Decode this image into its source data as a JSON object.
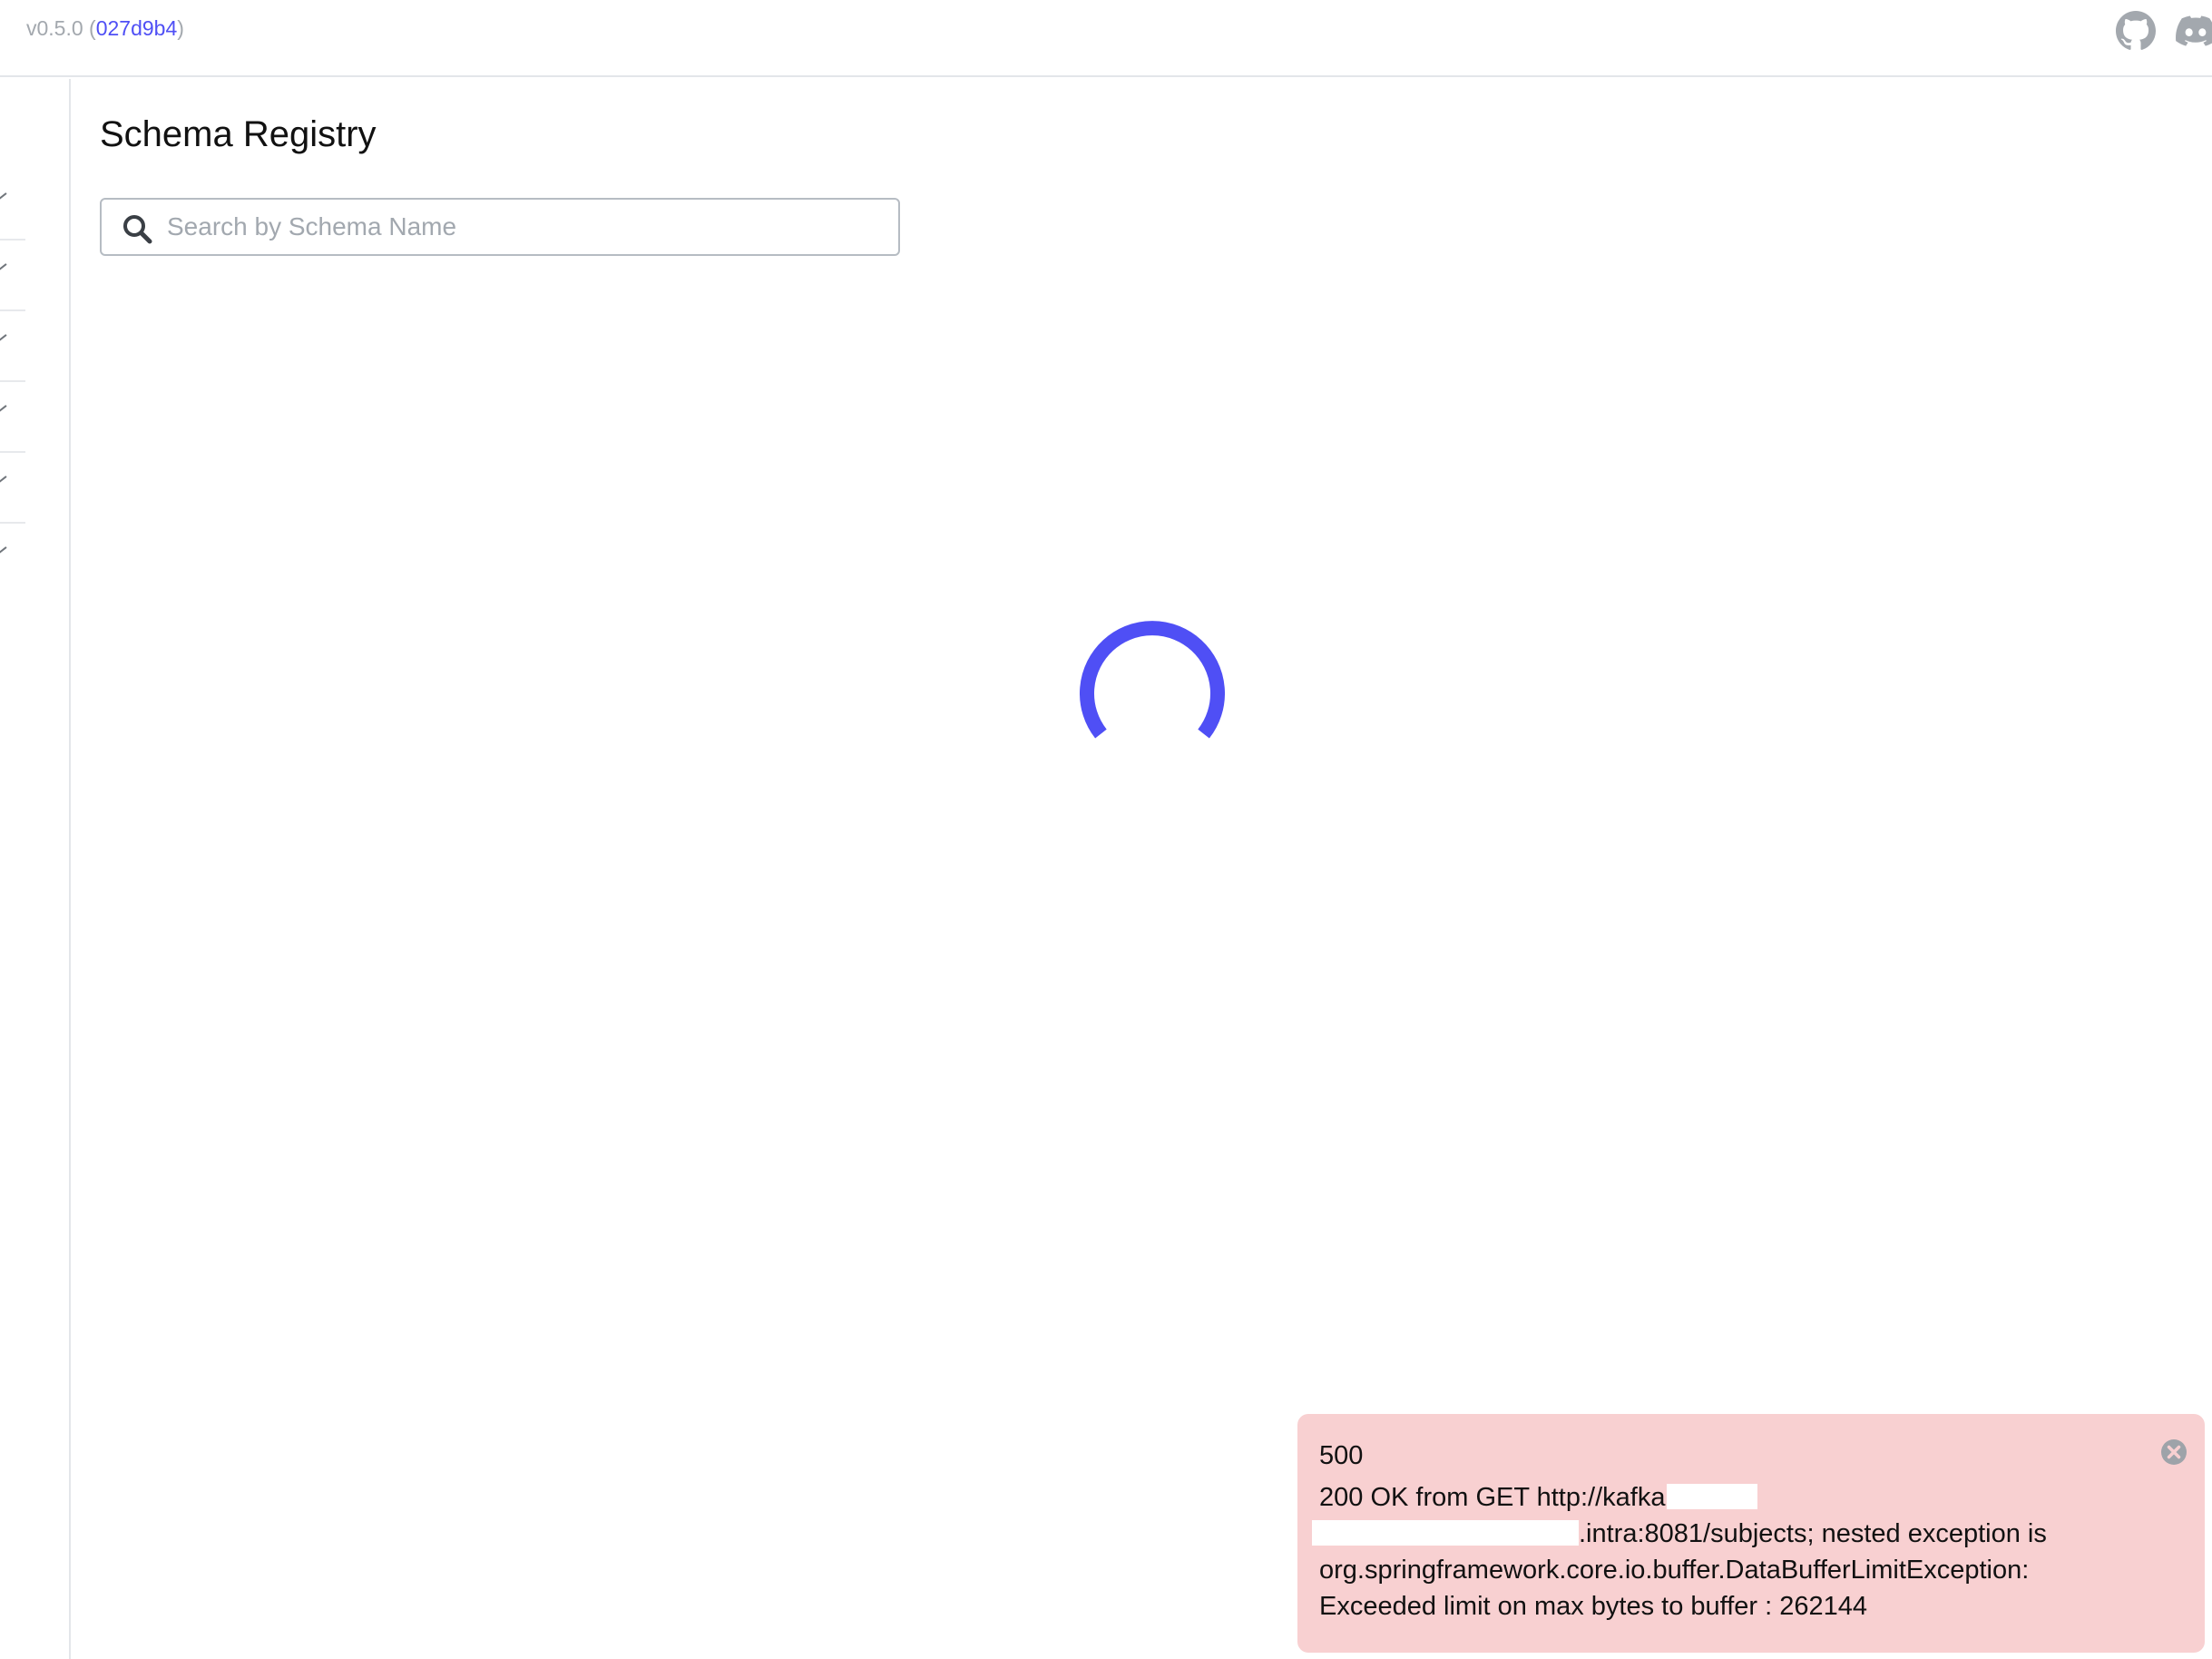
{
  "header": {
    "version": "v0.5.0",
    "commit_open": " (",
    "commit": "027d9b4",
    "commit_close": ")",
    "icons": [
      "github-icon",
      "discord-icon"
    ]
  },
  "sidebar": {
    "items": [
      {
        "icon": "chevron-icon"
      },
      {
        "icon": "chevron-icon"
      },
      {
        "icon": "chevron-icon"
      },
      {
        "icon": "chevron-icon"
      },
      {
        "icon": "chevron-icon"
      },
      {
        "icon": "chevron-icon"
      }
    ]
  },
  "main": {
    "title": "Schema Registry",
    "search": {
      "placeholder": "Search by Schema Name",
      "value": "",
      "icon": "search-icon"
    },
    "loading_spinner_color": "#4f4ff5"
  },
  "toast": {
    "code": "500",
    "line1": "200 OK from GET http://kafka",
    "line2": ".intra:8081/subjects; nested exception is",
    "line3": "org.springframework.core.io.buffer.DataBufferLimitException:",
    "line4": "Exceeded limit on max bytes to buffer : 262144",
    "background": "#f8d0d1",
    "close_icon": "close-circle-icon"
  }
}
